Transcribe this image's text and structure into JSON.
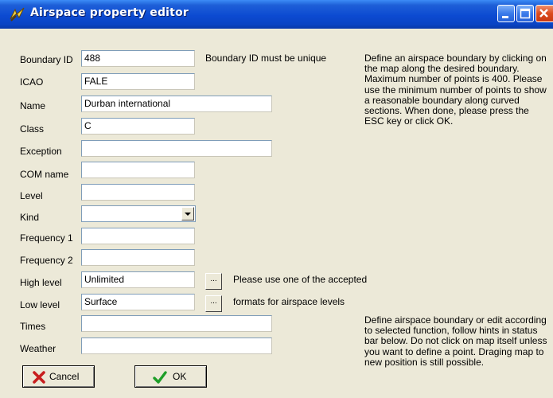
{
  "window": {
    "title": "Airspace property editor"
  },
  "form": {
    "boundary_id": {
      "label": "Boundary ID",
      "value": "488",
      "hint": "Boundary ID must be unique"
    },
    "icao": {
      "label": "ICAO",
      "value": "FALE"
    },
    "name": {
      "label": "Name",
      "value": "Durban international"
    },
    "class": {
      "label": "Class",
      "value": "C"
    },
    "exception": {
      "label": "Exception",
      "value": ""
    },
    "com_name": {
      "label": "COM name",
      "value": ""
    },
    "level": {
      "label": "Level",
      "value": ""
    },
    "kind": {
      "label": "Kind",
      "value": ""
    },
    "frequency1": {
      "label": "Frequency 1",
      "value": ""
    },
    "frequency2": {
      "label": "Frequency 2",
      "value": ""
    },
    "high_level": {
      "label": "High level",
      "value": "Unlimited",
      "button": "..."
    },
    "low_level": {
      "label": "Low level",
      "value": "Surface",
      "button": "..."
    },
    "times": {
      "label": "Times",
      "value": ""
    },
    "weather": {
      "label": "Weather",
      "value": ""
    },
    "levels_hint_line1": "Please use one of the accepted",
    "levels_hint_line2": "formats for airspace levels"
  },
  "info": {
    "top_text": "Define an airspace boundary by clicking on the map along the desired boundary. Maximum number of points is 400. Please use the minimum number of points to show a reasonable boundary along curved sections. When done, please press the ESC key or click OK.",
    "bottom_text": "Define airspace boundary or edit according to selected function, follow hints in status bar below. Do not click on map itself unless you want to define a point. Draging map to new position is still possible."
  },
  "buttons": {
    "cancel": "Cancel",
    "ok": "OK"
  },
  "icons": {
    "app": "airspace-editor-icon",
    "minimize": "minimize-icon",
    "maximize": "maximize-icon",
    "close": "close-icon",
    "cancel": "red-x-icon",
    "ok": "green-check-icon",
    "dropdown": "chevron-down-icon"
  },
  "colors": {
    "titlebar": "#0A44C4",
    "window_bg": "#ECE9D8",
    "close_button": "#D9481C",
    "cancel_icon": "#C81E1E",
    "ok_icon": "#1E9E28"
  }
}
